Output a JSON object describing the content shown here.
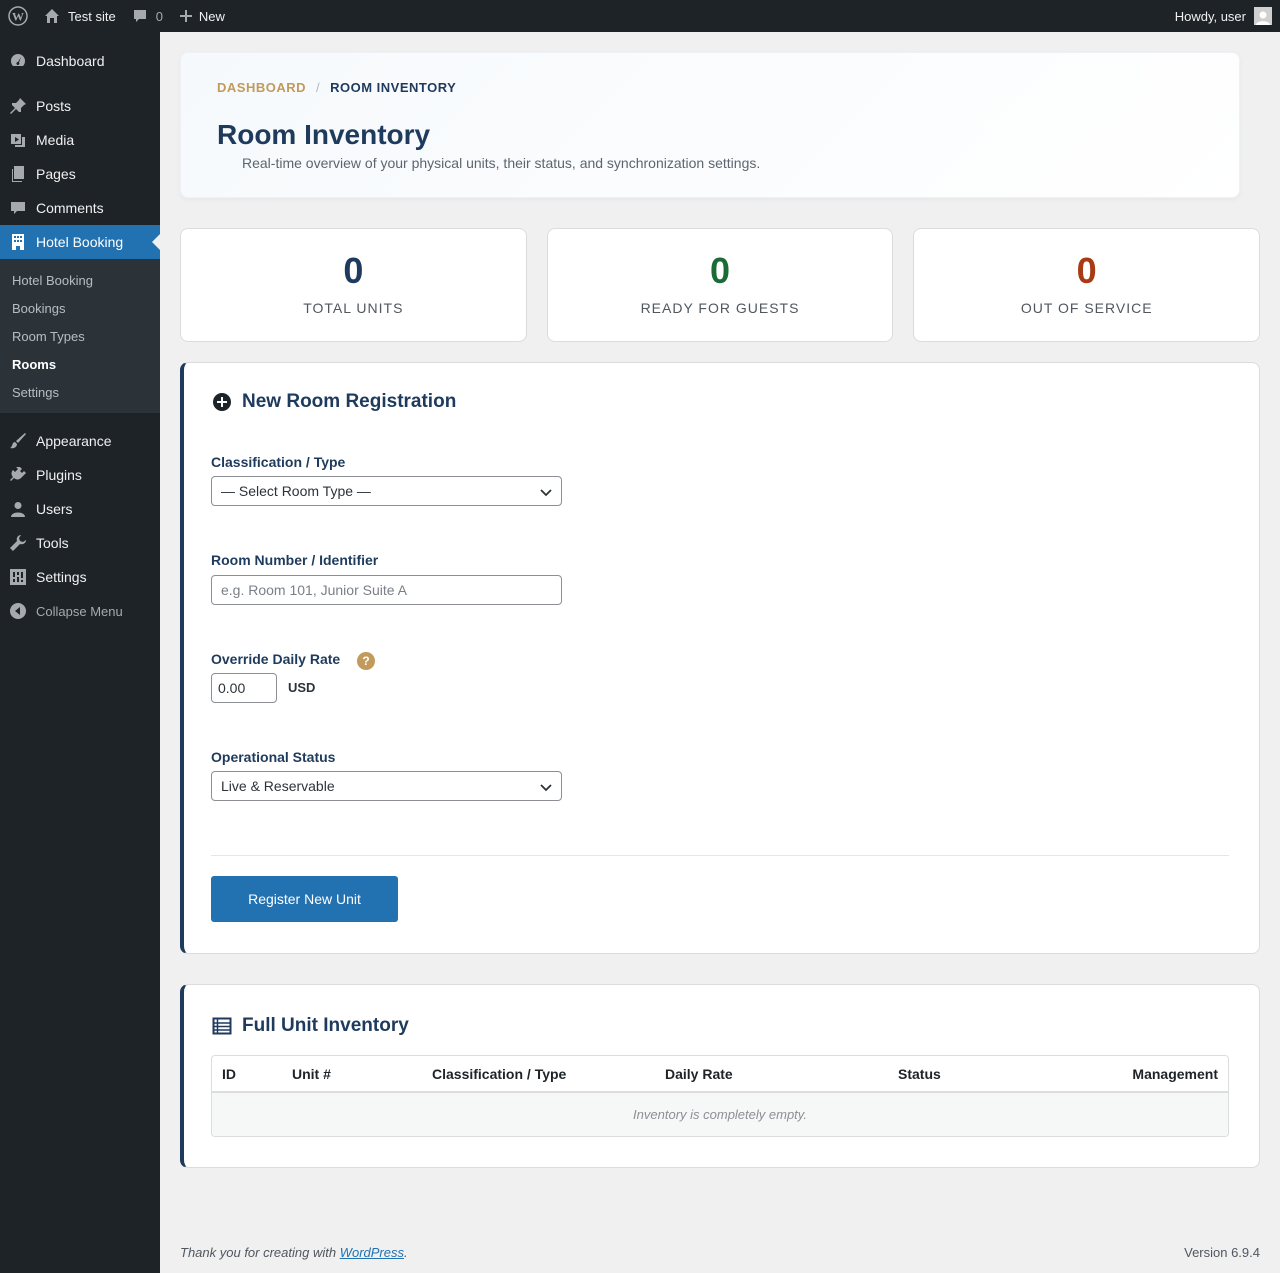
{
  "adminbar": {
    "site_name": "Test site",
    "comments_count": "0",
    "new_label": "New",
    "greeting": "Howdy, user"
  },
  "sidebar": {
    "items": [
      {
        "label": "Dashboard",
        "icon": "dashboard-icon"
      },
      {
        "label": "Posts",
        "icon": "pin-icon"
      },
      {
        "label": "Media",
        "icon": "media-icon"
      },
      {
        "label": "Pages",
        "icon": "pages-icon"
      },
      {
        "label": "Comments",
        "icon": "comment-icon"
      },
      {
        "label": "Hotel Booking",
        "icon": "building-icon"
      }
    ],
    "submenu": [
      "Hotel Booking",
      "Bookings",
      "Room Types",
      "Rooms",
      "Settings"
    ],
    "items_after": [
      {
        "label": "Appearance",
        "icon": "brush-icon"
      },
      {
        "label": "Plugins",
        "icon": "plugin-icon"
      },
      {
        "label": "Users",
        "icon": "user-icon"
      },
      {
        "label": "Tools",
        "icon": "wrench-icon"
      },
      {
        "label": "Settings",
        "icon": "settings-icon"
      }
    ],
    "collapse_label": "Collapse Menu"
  },
  "header": {
    "breadcrumb_home": "DASHBOARD",
    "breadcrumb_sep": "/",
    "breadcrumb_current": "ROOM INVENTORY",
    "title": "Room Inventory",
    "subtitle": "Real-time overview of your physical units, their status, and synchronization settings."
  },
  "stats": [
    {
      "value": "0",
      "label": "TOTAL UNITS",
      "color": "#1e3a5c"
    },
    {
      "value": "0",
      "label": "READY FOR GUESTS",
      "color": "#1a6b35"
    },
    {
      "value": "0",
      "label": "OUT OF SERVICE",
      "color": "#a83a14"
    }
  ],
  "form": {
    "title": "New Room Registration",
    "type_label": "Classification / Type",
    "type_value": "— Select Room Type —",
    "number_label": "Room Number / Identifier",
    "number_placeholder": "e.g. Room 101, Junior Suite A",
    "rate_label": "Override Daily Rate",
    "rate_value": "0.00",
    "currency": "USD",
    "help": "?",
    "status_label": "Operational Status",
    "status_value": "Live & Reservable",
    "submit_label": "Register New Unit"
  },
  "inventory": {
    "title": "Full Unit Inventory",
    "columns": [
      "ID",
      "Unit #",
      "Classification / Type",
      "Daily Rate",
      "Status",
      "Management"
    ],
    "empty_message": "Inventory is completely empty."
  },
  "footer": {
    "thanks_prefix": "Thank you for creating with ",
    "thanks_link": "WordPress",
    "thanks_suffix": ".",
    "version": "Version 6.9.4"
  }
}
